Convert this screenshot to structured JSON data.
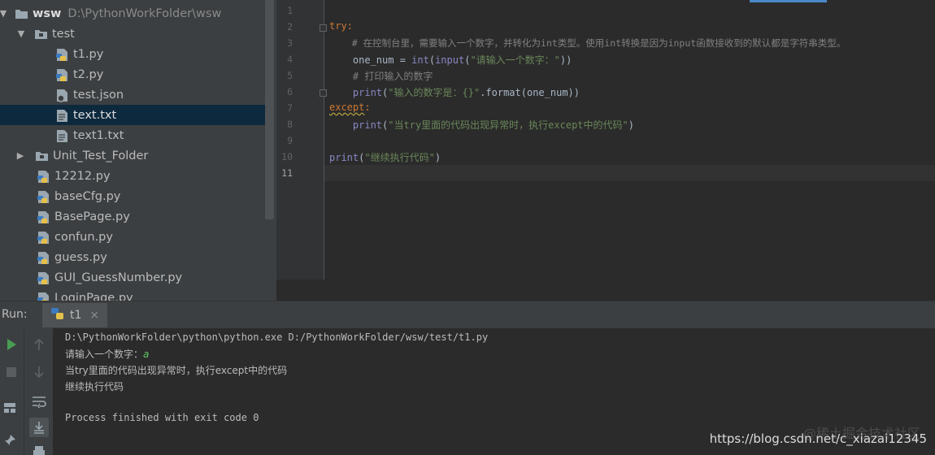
{
  "project": {
    "root_name": "wsw",
    "root_path": "D:\\PythonWorkFolder\\wsw",
    "items": [
      {
        "label": "test",
        "icon": "folder-icon",
        "expanded": true
      },
      {
        "label": "t1.py",
        "icon": "python-file-icon"
      },
      {
        "label": "t2.py",
        "icon": "python-file-icon"
      },
      {
        "label": "test.json",
        "icon": "json-file-icon"
      },
      {
        "label": "text.txt",
        "icon": "text-file-icon",
        "selected": true
      },
      {
        "label": "text1.txt",
        "icon": "text-file-icon"
      },
      {
        "label": "Unit_Test_Folder",
        "icon": "folder-icon",
        "expanded": false
      },
      {
        "label": "12212.py",
        "icon": "python-file-icon"
      },
      {
        "label": "baseCfg.py",
        "icon": "python-file-icon"
      },
      {
        "label": "BasePage.py",
        "icon": "python-file-icon"
      },
      {
        "label": "confun.py",
        "icon": "python-file-icon"
      },
      {
        "label": "guess.py",
        "icon": "python-file-icon"
      },
      {
        "label": "GUI_GuessNumber.py",
        "icon": "python-file-icon"
      },
      {
        "label": "LoginPage.py",
        "icon": "python-file-icon"
      }
    ]
  },
  "editor": {
    "current_line": 11,
    "line_numbers": [
      "1",
      "2",
      "3",
      "4",
      "5",
      "6",
      "7",
      "8",
      "9",
      "10",
      "11"
    ],
    "code": {
      "l2_kw": "try",
      "l2_rest": ":",
      "l3": "    # 在控制台里，需要输入一个数字，并转化为int类型。使用int转换是因为input函数接收到的默认都是字符串类型。",
      "l4_a": "    one_num = ",
      "l4_int": "int",
      "l4_b": "(",
      "l4_input": "input",
      "l4_c": "(",
      "l4_str": "\"请输入一个数字：\"",
      "l4_d": "))",
      "l5": "    # 打印输入的数字",
      "l6_print": "    print",
      "l6_a": "(",
      "l6_str": "\"输入的数字是：{}\"",
      "l6_b": ".format(one_num))",
      "l7_kw": "except",
      "l7_rest": ":",
      "l8_print": "    print",
      "l8_a": "(",
      "l8_str": "\"当try里面的代码出现异常时，执行except中的代码\"",
      "l8_b": ")",
      "l10_print": "print",
      "l10_a": "(",
      "l10_str": "\"继续执行代码\"",
      "l10_b": ")"
    }
  },
  "run": {
    "label": "Run:",
    "tab_name": "t1",
    "close_glyph": "×",
    "output": {
      "command": "D:\\PythonWorkFolder\\python\\python.exe D:/PythonWorkFolder/wsw/test/t1.py",
      "prompt": "请输入一个数字：",
      "user_input": "a",
      "line3": "当try里面的代码出现异常时，执行except中的代码",
      "line4": "继续执行代码",
      "finished": "Process finished with exit code 0"
    }
  },
  "watermark": {
    "text": "@稀土掘金技术社区",
    "url": "https://blog.csdn.net/c_xiazai12345"
  },
  "colors": {
    "keyword": "#cc7832",
    "comment": "#808080",
    "string": "#6a8759",
    "builtin": "#8888c6",
    "selection": "#0d293e",
    "run_green": "#499c54"
  }
}
